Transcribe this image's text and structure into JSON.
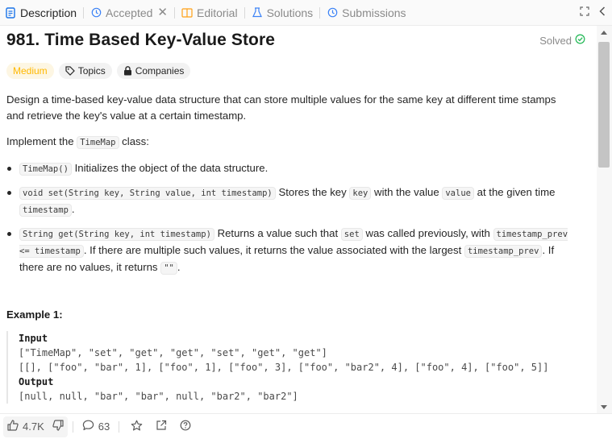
{
  "tabs": [
    {
      "label": "Description",
      "icon": "description-icon",
      "active": true
    },
    {
      "label": "Accepted",
      "icon": "history-icon",
      "active": false,
      "closable": true
    },
    {
      "label": "Editorial",
      "icon": "book-icon",
      "active": false
    },
    {
      "label": "Solutions",
      "icon": "flask-icon",
      "active": false
    },
    {
      "label": "Submissions",
      "icon": "history-icon",
      "active": false
    }
  ],
  "problem": {
    "title": "981. Time Based Key-Value Store",
    "status": "Solved",
    "difficulty": "Medium",
    "topics_label": "Topics",
    "companies_label": "Companies"
  },
  "description": {
    "intro": "Design a time-based key-value data structure that can store multiple values for the same key at different time stamps and retrieve the key's value at a certain timestamp.",
    "implement_prefix": "Implement the",
    "implement_code": "TimeMap",
    "implement_suffix": "class:",
    "item1_code": "TimeMap()",
    "item1_text": "Initializes the object of the data structure.",
    "item2_code": "void set(String key, String value, int timestamp)",
    "item2_text_a": "Stores the key",
    "item2_code_key": "key",
    "item2_text_b": "with the value",
    "item2_code_value": "value",
    "item2_text_c": "at the given time",
    "item2_code_ts": "timestamp",
    "item2_text_d": ".",
    "item3_code": "String get(String key, int timestamp)",
    "item3_text_a": "Returns a value such that",
    "item3_code_set": "set",
    "item3_text_b": "was called previously, with",
    "item3_code_prev": "timestamp_prev <= timestamp",
    "item3_text_c": ". If there are multiple such values, it returns the value associated with the largest",
    "item3_code_prev2": "timestamp_prev",
    "item3_text_d": ". If there are no values, it returns",
    "item3_code_empty": "\"\"",
    "item3_text_e": "."
  },
  "example": {
    "title": "Example 1:",
    "input_label": "Input",
    "input_line1": "[\"TimeMap\", \"set\", \"get\", \"get\", \"set\", \"get\", \"get\"]",
    "input_line2": "[[], [\"foo\", \"bar\", 1], [\"foo\", 1], [\"foo\", 3], [\"foo\", \"bar2\", 4], [\"foo\", 4], [\"foo\", 5]]",
    "output_label": "Output",
    "output_line1": "[null, null, \"bar\", \"bar\", null, \"bar2\", \"bar2\"]"
  },
  "footer": {
    "likes": "4.7K",
    "comments": "63"
  },
  "colors": {
    "medium": "#ffb800",
    "solved_check": "#2cbb5d",
    "description_icon": "#1a73e8",
    "editorial_icon": "#ffa116",
    "solutions_icon": "#3b82f6",
    "submissions_icon": "#3b82f6"
  }
}
